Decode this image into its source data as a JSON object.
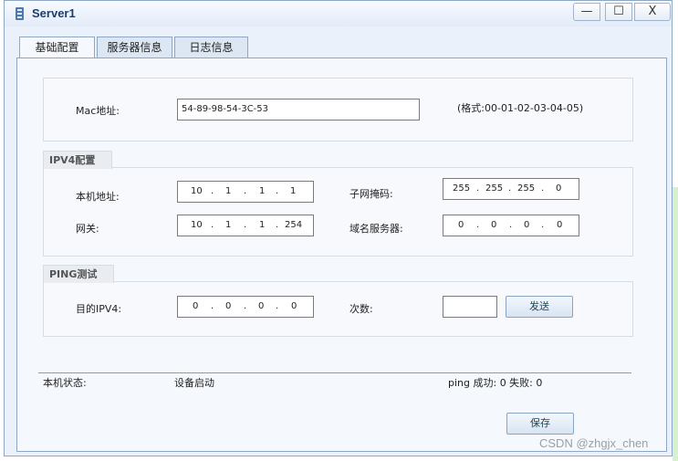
{
  "window": {
    "title": "Server1",
    "buttons": {
      "minimize": "—",
      "maximize": "☐",
      "close": "X"
    }
  },
  "tabs": [
    {
      "label": "基础配置",
      "active": true
    },
    {
      "label": "服务器信息",
      "active": false
    },
    {
      "label": "日志信息",
      "active": false
    }
  ],
  "mac": {
    "label": "Mac地址:",
    "value": "54-89-98-54-3C-53",
    "format_hint": "(格式:00-01-02-03-04-05)"
  },
  "ipv4": {
    "group_title": "IPV4配置",
    "local_ip": {
      "label": "本机地址:",
      "octets": [
        "10",
        "1",
        "1",
        "1"
      ]
    },
    "subnet_mask": {
      "label": "子网掩码:",
      "octets": [
        "255",
        "255",
        "255",
        "0"
      ]
    },
    "gateway": {
      "label": "网关:",
      "octets": [
        "10",
        "1",
        "1",
        "254"
      ]
    },
    "dns": {
      "label": "域名服务器:",
      "octets": [
        "0",
        "0",
        "0",
        "0"
      ]
    }
  },
  "ping": {
    "group_title": "PING测试",
    "dest": {
      "label": "目的IPV4:",
      "octets": [
        "0",
        "0",
        "0",
        "0"
      ]
    },
    "count": {
      "label": "次数:",
      "value": ""
    },
    "send_label": "发送"
  },
  "status": {
    "label": "本机状态:",
    "value": "设备启动",
    "ping_result": "ping 成功: 0 失败: 0"
  },
  "save_label": "保存",
  "watermark": "CSDN @zhgjx_chen",
  "colors": {
    "window_bg": "#eaf1fa",
    "panel_bg": "#f5f8fc",
    "title_text": "#1e3d6b",
    "border": "#8ea7c7"
  }
}
